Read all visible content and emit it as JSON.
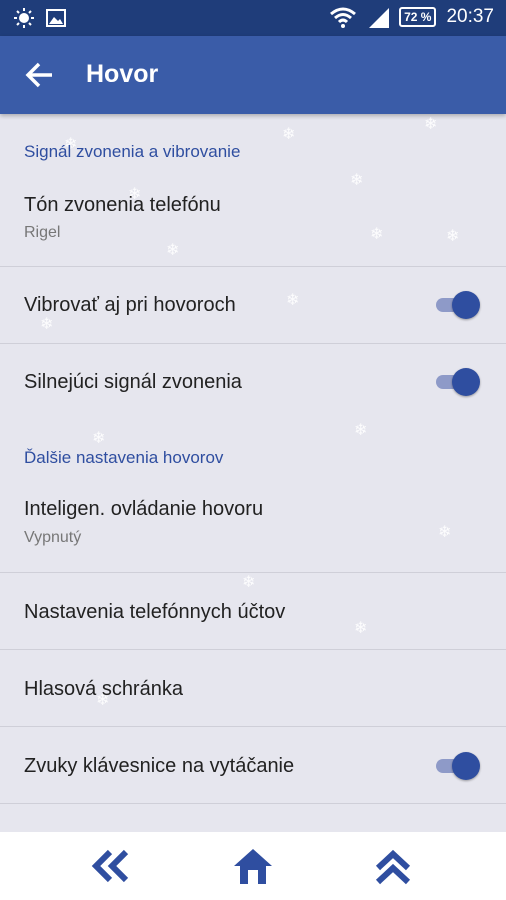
{
  "status_bar": {
    "battery": "72 %",
    "time": "20:37"
  },
  "app_bar": {
    "title": "Hovor"
  },
  "sections": [
    {
      "header": "Signál zvonenia a vibrovanie",
      "items": [
        {
          "title": "Tón zvonenia telefónu",
          "subtitle": "Rigel"
        },
        {
          "title": "Vibrovať aj pri hovoroch",
          "toggle_on": true
        },
        {
          "title": "Silnejúci signál zvonenia",
          "toggle_on": true
        }
      ]
    },
    {
      "header": "Ďalšie nastavenia hovorov",
      "items": [
        {
          "title": "Inteligen. ovládanie hovoru",
          "subtitle": "Vypnutý"
        },
        {
          "title": "Nastavenia telefónnych účtov"
        },
        {
          "title": "Hlasová schránka"
        },
        {
          "title": "Zvuky klávesnice na vytáčanie",
          "toggle_on": true
        }
      ]
    }
  ],
  "icons": {
    "status_left": [
      "brightness-icon",
      "image-icon"
    ],
    "status_right": [
      "wifi-icon",
      "signal-icon",
      "battery-icon"
    ],
    "bottom_nav": [
      "double-chevron-left-icon",
      "home-icon",
      "double-chevron-up-icon"
    ]
  },
  "colors": {
    "status_bar": "#1f3d7a",
    "app_bar": "#3a5ca8",
    "accent": "#2f4ea0",
    "background": "#e6e6ee"
  }
}
